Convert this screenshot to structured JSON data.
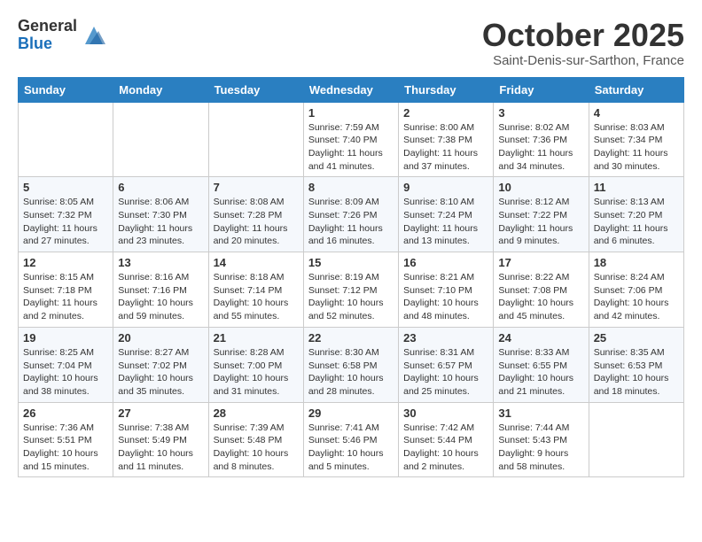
{
  "header": {
    "logo_general": "General",
    "logo_blue": "Blue",
    "month_title": "October 2025",
    "subtitle": "Saint-Denis-sur-Sarthon, France"
  },
  "days_of_week": [
    "Sunday",
    "Monday",
    "Tuesday",
    "Wednesday",
    "Thursday",
    "Friday",
    "Saturday"
  ],
  "weeks": [
    [
      {
        "day": "",
        "sunrise": "",
        "sunset": "",
        "daylight": ""
      },
      {
        "day": "",
        "sunrise": "",
        "sunset": "",
        "daylight": ""
      },
      {
        "day": "",
        "sunrise": "",
        "sunset": "",
        "daylight": ""
      },
      {
        "day": "1",
        "sunrise": "Sunrise: 7:59 AM",
        "sunset": "Sunset: 7:40 PM",
        "daylight": "Daylight: 11 hours and 41 minutes."
      },
      {
        "day": "2",
        "sunrise": "Sunrise: 8:00 AM",
        "sunset": "Sunset: 7:38 PM",
        "daylight": "Daylight: 11 hours and 37 minutes."
      },
      {
        "day": "3",
        "sunrise": "Sunrise: 8:02 AM",
        "sunset": "Sunset: 7:36 PM",
        "daylight": "Daylight: 11 hours and 34 minutes."
      },
      {
        "day": "4",
        "sunrise": "Sunrise: 8:03 AM",
        "sunset": "Sunset: 7:34 PM",
        "daylight": "Daylight: 11 hours and 30 minutes."
      }
    ],
    [
      {
        "day": "5",
        "sunrise": "Sunrise: 8:05 AM",
        "sunset": "Sunset: 7:32 PM",
        "daylight": "Daylight: 11 hours and 27 minutes."
      },
      {
        "day": "6",
        "sunrise": "Sunrise: 8:06 AM",
        "sunset": "Sunset: 7:30 PM",
        "daylight": "Daylight: 11 hours and 23 minutes."
      },
      {
        "day": "7",
        "sunrise": "Sunrise: 8:08 AM",
        "sunset": "Sunset: 7:28 PM",
        "daylight": "Daylight: 11 hours and 20 minutes."
      },
      {
        "day": "8",
        "sunrise": "Sunrise: 8:09 AM",
        "sunset": "Sunset: 7:26 PM",
        "daylight": "Daylight: 11 hours and 16 minutes."
      },
      {
        "day": "9",
        "sunrise": "Sunrise: 8:10 AM",
        "sunset": "Sunset: 7:24 PM",
        "daylight": "Daylight: 11 hours and 13 minutes."
      },
      {
        "day": "10",
        "sunrise": "Sunrise: 8:12 AM",
        "sunset": "Sunset: 7:22 PM",
        "daylight": "Daylight: 11 hours and 9 minutes."
      },
      {
        "day": "11",
        "sunrise": "Sunrise: 8:13 AM",
        "sunset": "Sunset: 7:20 PM",
        "daylight": "Daylight: 11 hours and 6 minutes."
      }
    ],
    [
      {
        "day": "12",
        "sunrise": "Sunrise: 8:15 AM",
        "sunset": "Sunset: 7:18 PM",
        "daylight": "Daylight: 11 hours and 2 minutes."
      },
      {
        "day": "13",
        "sunrise": "Sunrise: 8:16 AM",
        "sunset": "Sunset: 7:16 PM",
        "daylight": "Daylight: 10 hours and 59 minutes."
      },
      {
        "day": "14",
        "sunrise": "Sunrise: 8:18 AM",
        "sunset": "Sunset: 7:14 PM",
        "daylight": "Daylight: 10 hours and 55 minutes."
      },
      {
        "day": "15",
        "sunrise": "Sunrise: 8:19 AM",
        "sunset": "Sunset: 7:12 PM",
        "daylight": "Daylight: 10 hours and 52 minutes."
      },
      {
        "day": "16",
        "sunrise": "Sunrise: 8:21 AM",
        "sunset": "Sunset: 7:10 PM",
        "daylight": "Daylight: 10 hours and 48 minutes."
      },
      {
        "day": "17",
        "sunrise": "Sunrise: 8:22 AM",
        "sunset": "Sunset: 7:08 PM",
        "daylight": "Daylight: 10 hours and 45 minutes."
      },
      {
        "day": "18",
        "sunrise": "Sunrise: 8:24 AM",
        "sunset": "Sunset: 7:06 PM",
        "daylight": "Daylight: 10 hours and 42 minutes."
      }
    ],
    [
      {
        "day": "19",
        "sunrise": "Sunrise: 8:25 AM",
        "sunset": "Sunset: 7:04 PM",
        "daylight": "Daylight: 10 hours and 38 minutes."
      },
      {
        "day": "20",
        "sunrise": "Sunrise: 8:27 AM",
        "sunset": "Sunset: 7:02 PM",
        "daylight": "Daylight: 10 hours and 35 minutes."
      },
      {
        "day": "21",
        "sunrise": "Sunrise: 8:28 AM",
        "sunset": "Sunset: 7:00 PM",
        "daylight": "Daylight: 10 hours and 31 minutes."
      },
      {
        "day": "22",
        "sunrise": "Sunrise: 8:30 AM",
        "sunset": "Sunset: 6:58 PM",
        "daylight": "Daylight: 10 hours and 28 minutes."
      },
      {
        "day": "23",
        "sunrise": "Sunrise: 8:31 AM",
        "sunset": "Sunset: 6:57 PM",
        "daylight": "Daylight: 10 hours and 25 minutes."
      },
      {
        "day": "24",
        "sunrise": "Sunrise: 8:33 AM",
        "sunset": "Sunset: 6:55 PM",
        "daylight": "Daylight: 10 hours and 21 minutes."
      },
      {
        "day": "25",
        "sunrise": "Sunrise: 8:35 AM",
        "sunset": "Sunset: 6:53 PM",
        "daylight": "Daylight: 10 hours and 18 minutes."
      }
    ],
    [
      {
        "day": "26",
        "sunrise": "Sunrise: 7:36 AM",
        "sunset": "Sunset: 5:51 PM",
        "daylight": "Daylight: 10 hours and 15 minutes."
      },
      {
        "day": "27",
        "sunrise": "Sunrise: 7:38 AM",
        "sunset": "Sunset: 5:49 PM",
        "daylight": "Daylight: 10 hours and 11 minutes."
      },
      {
        "day": "28",
        "sunrise": "Sunrise: 7:39 AM",
        "sunset": "Sunset: 5:48 PM",
        "daylight": "Daylight: 10 hours and 8 minutes."
      },
      {
        "day": "29",
        "sunrise": "Sunrise: 7:41 AM",
        "sunset": "Sunset: 5:46 PM",
        "daylight": "Daylight: 10 hours and 5 minutes."
      },
      {
        "day": "30",
        "sunrise": "Sunrise: 7:42 AM",
        "sunset": "Sunset: 5:44 PM",
        "daylight": "Daylight: 10 hours and 2 minutes."
      },
      {
        "day": "31",
        "sunrise": "Sunrise: 7:44 AM",
        "sunset": "Sunset: 5:43 PM",
        "daylight": "Daylight: 9 hours and 58 minutes."
      },
      {
        "day": "",
        "sunrise": "",
        "sunset": "",
        "daylight": ""
      }
    ]
  ]
}
